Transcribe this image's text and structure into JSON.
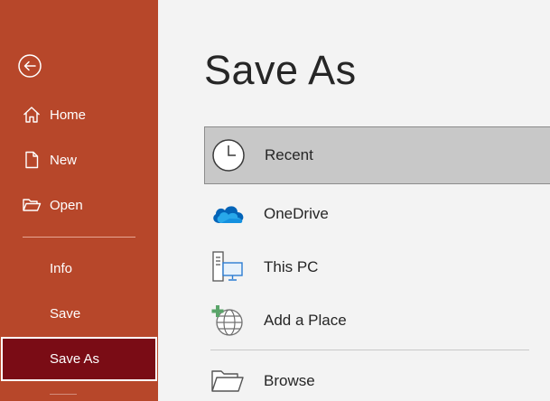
{
  "nav": {
    "items": [
      {
        "label": "Home",
        "icon": "home-icon"
      },
      {
        "label": "New",
        "icon": "new-document-icon"
      },
      {
        "label": "Open",
        "icon": "open-folder-icon"
      }
    ],
    "secondary": [
      {
        "label": "Info"
      },
      {
        "label": "Save"
      },
      {
        "label": "Save As",
        "active": true
      }
    ],
    "back_icon": "back-arrow-icon",
    "colors": {
      "background": "#b7472a",
      "active": "#7a0c15",
      "text": "#ffffff"
    }
  },
  "main": {
    "title": "Save As",
    "locations": [
      {
        "label": "Recent",
        "icon": "clock-icon",
        "selected": true
      },
      {
        "label": "OneDrive",
        "icon": "onedrive-cloud-icon"
      },
      {
        "label": "This PC",
        "icon": "this-pc-icon"
      },
      {
        "label": "Add a Place",
        "icon": "add-place-globe-icon"
      },
      {
        "label": "Browse",
        "icon": "browse-folder-icon"
      }
    ]
  }
}
